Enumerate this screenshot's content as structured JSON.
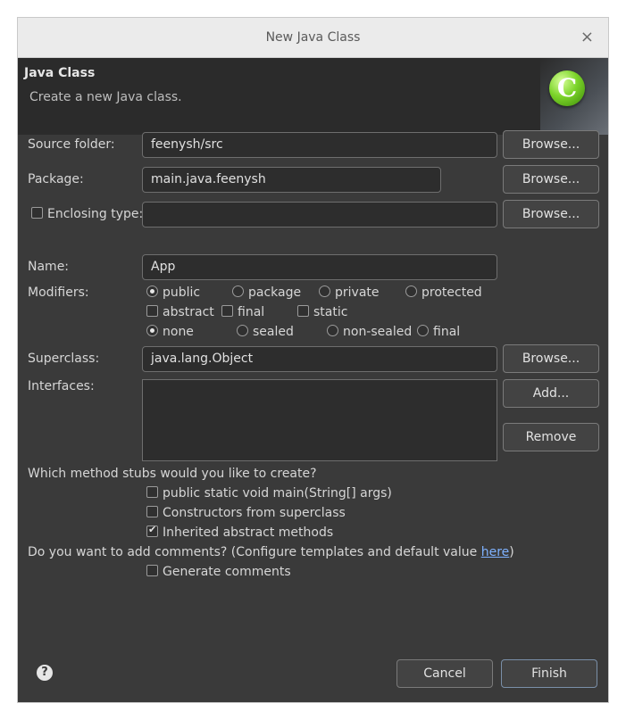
{
  "window": {
    "title": "New Java Class",
    "close_glyph": "×"
  },
  "banner": {
    "heading": "Java Class",
    "subtitle": "Create a new Java class.",
    "icon": "java-class-icon",
    "icon_letter": "C"
  },
  "form": {
    "source_folder": {
      "label": "Source folder:",
      "value": "feenysh/src",
      "button": "Browse..."
    },
    "package": {
      "label": "Package:",
      "value": "main.java.feenysh",
      "button": "Browse..."
    },
    "enclosing": {
      "label": "Enclosing type:",
      "value": "",
      "checked": false,
      "button": "Browse..."
    },
    "name": {
      "label": "Name:",
      "value": "App"
    },
    "modifiers": {
      "label": "Modifiers:",
      "access": [
        "public",
        "package",
        "private",
        "protected"
      ],
      "access_selected": "public",
      "flags": [
        "abstract",
        "final",
        "static"
      ],
      "sealing": [
        "none",
        "sealed",
        "non-sealed",
        "final"
      ],
      "sealing_selected": "none"
    },
    "superclass": {
      "label": "Superclass:",
      "value": "java.lang.Object",
      "button": "Browse..."
    },
    "interfaces": {
      "label": "Interfaces:",
      "add": "Add...",
      "remove": "Remove"
    }
  },
  "stubs": {
    "question": "Which method stubs would you like to create?",
    "main": "public static void main(String[] args)",
    "constructors": "Constructors from superclass",
    "inherited": "Inherited abstract methods",
    "inherited_checked": true
  },
  "comments": {
    "question_prefix": "Do you want to add comments? (Configure templates and default value ",
    "link": "here",
    "question_suffix": ")",
    "generate": "Generate comments"
  },
  "footer": {
    "help_glyph": "?",
    "cancel": "Cancel",
    "finish": "Finish"
  },
  "colors": {
    "dialog_bg": "#3a3a3a",
    "field_bg": "#2d2d2d",
    "link": "#7fb2ff",
    "logo_green": "#7cd42a"
  }
}
